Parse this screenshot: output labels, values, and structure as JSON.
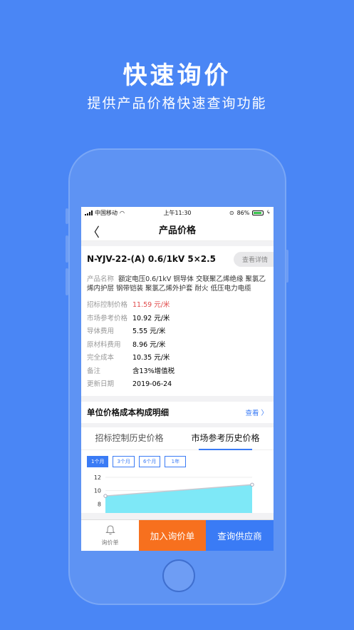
{
  "hero": {
    "title": "快速询价",
    "subtitle": "提供产品价格快速查询功能"
  },
  "status_bar": {
    "carrier": "中国移动",
    "time": "上午11:30",
    "battery": "86%",
    "battery_level": 0.86
  },
  "nav": {
    "title": "产品价格"
  },
  "product": {
    "name": "N-YJV-22-(A)  0.6/1kV  5×2.5",
    "detail_button": "查看详情",
    "desc_label": "产品名称",
    "desc_value": "额定电压0.6/1kV 铜导体 交联聚乙烯绝缘 聚氯乙烯内护层 钢带铠装 聚氯乙烯外护套 耐火 低压电力电缆",
    "fields": [
      {
        "label": "招标控制价格",
        "value": "11.59 元/米"
      },
      {
        "label": "市场参考价格",
        "value": "10.92 元/米"
      },
      {
        "label": "导体费用",
        "value": "5.55 元/米"
      },
      {
        "label": "原材料费用",
        "value": "8.96 元/米"
      },
      {
        "label": "完全成本",
        "value": "10.35 元/米"
      },
      {
        "label": "备注",
        "value": "含13%增值税"
      },
      {
        "label": "更新日期",
        "value": "2019-06-24"
      }
    ]
  },
  "cost_section": {
    "title": "单位价格成本构成明细",
    "more": "查看 〉"
  },
  "history": {
    "tabs": [
      "招标控制历史价格",
      "市场参考历史价格"
    ],
    "active_tab": 1,
    "ranges": [
      "1个月",
      "3个月",
      "6个月",
      "1年"
    ],
    "active_range": 0
  },
  "chart_data": {
    "type": "area",
    "y_ticks": [
      "12",
      "10",
      "8"
    ],
    "ylim": [
      6,
      12
    ],
    "x": [
      0,
      1
    ],
    "values": [
      9.2,
      10.9
    ],
    "color": "#7ee8f7"
  },
  "bottom_bar": {
    "list_label": "询价单",
    "add_label": "加入询价单",
    "supplier_label": "查询供应商"
  },
  "colors": {
    "background": "#4a86f5",
    "accent": "#3a7bf5",
    "price_red": "#e04a4a",
    "add_orange": "#f7701e"
  }
}
